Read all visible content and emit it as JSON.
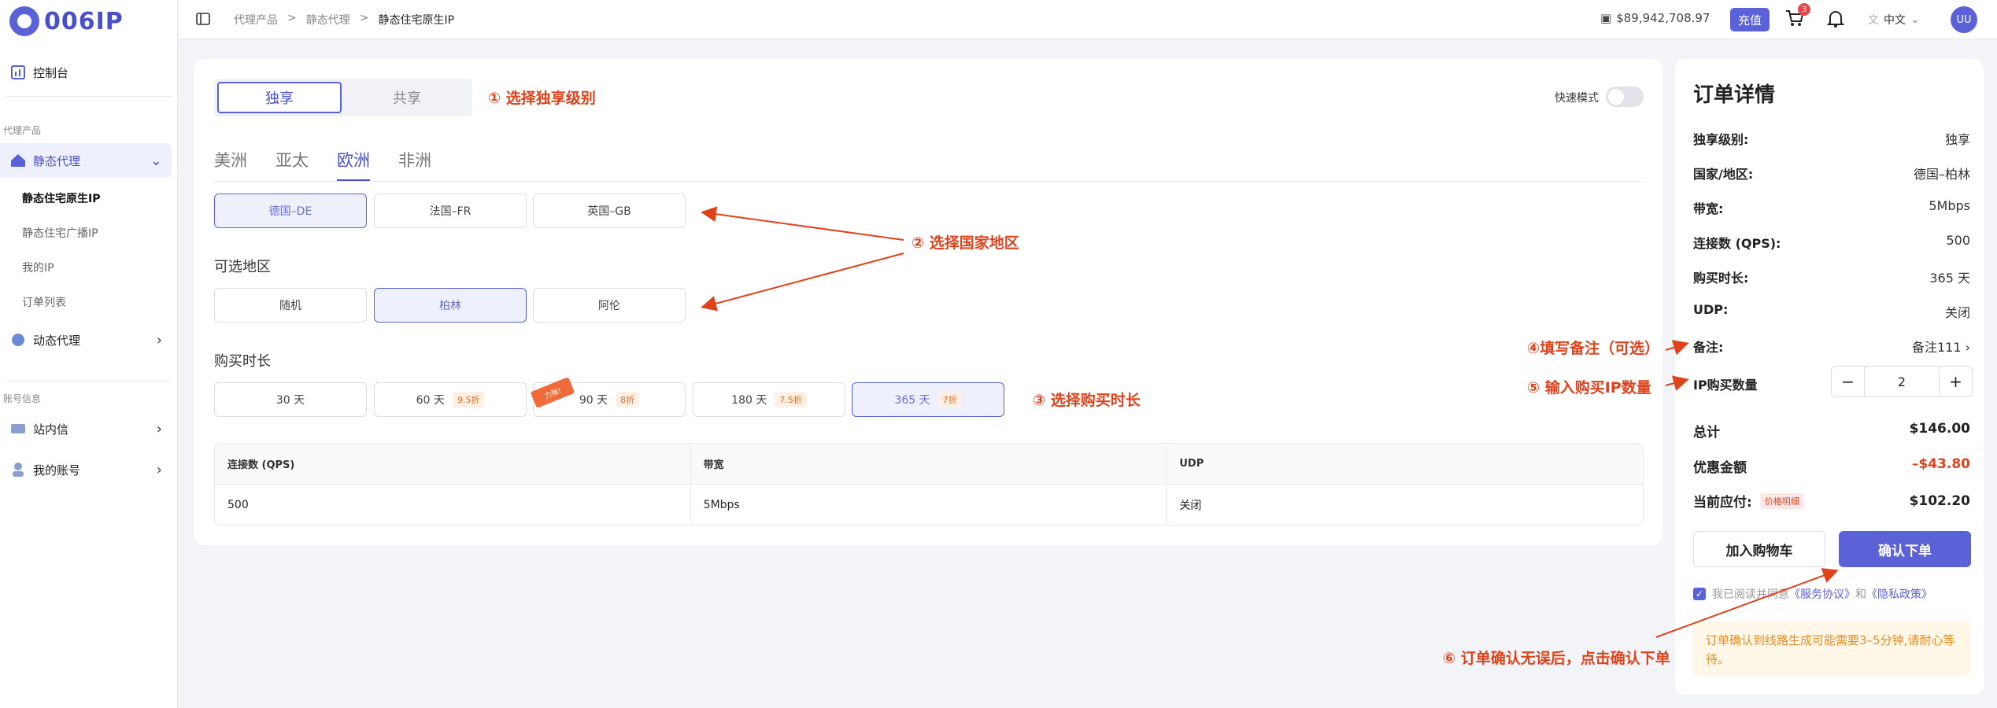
{
  "brand": {
    "logo_text": "006IP"
  },
  "sidebar": {
    "dashboard": "控制台",
    "sec_proxy": "代理产品",
    "static": "静态代理",
    "static_sub": [
      "静态住宅原生IP",
      "静态住宅广播IP",
      "我的IP",
      "订单列表"
    ],
    "dynamic": "动态代理",
    "sec_account": "账号信息",
    "inbox": "站内信",
    "account": "我的账号"
  },
  "topbar": {
    "crumbs": [
      "代理产品",
      ">",
      "静态代理",
      ">",
      "静态住宅原生IP"
    ],
    "balance": "$89,942,708.97",
    "recharge": "充值",
    "cart_badge": "3",
    "lang": "中文",
    "avatar": "UU"
  },
  "main": {
    "seg": [
      "独享",
      "共享"
    ],
    "quick_mode": "快速模式",
    "continents": [
      "美洲",
      "亚太",
      "欧洲",
      "非洲"
    ],
    "countries": [
      "德国–DE",
      "法国–FR",
      "英国–GB"
    ],
    "region_title": "可选地区",
    "regions": [
      "随机",
      "柏林",
      "阿伦"
    ],
    "duration_title": "购买时长",
    "durations": [
      {
        "label": "30 天",
        "disc": ""
      },
      {
        "label": "60 天",
        "disc": "9.5折"
      },
      {
        "label": "90 天",
        "disc": "8折"
      },
      {
        "label": "180 天",
        "disc": "7.5折"
      },
      {
        "label": "365 天",
        "disc": "7折"
      }
    ],
    "ribbon": "力推!",
    "table": {
      "headers": [
        "连接数 (QPS)",
        "带宽",
        "UDP"
      ],
      "row": [
        "500",
        "5Mbps",
        "关闭"
      ]
    }
  },
  "annotations": {
    "a1": "① 选择独享级别",
    "a2": "② 选择国家地区",
    "a3": "③ 选择购买时长",
    "a4": "④填写备注（可选）",
    "a5": "⑤ 输入购买IP数量",
    "a6": "⑥ 订单确认无误后，点击确认下单"
  },
  "order": {
    "title": "订单详情",
    "rows": [
      [
        "独享级别:",
        "独享"
      ],
      [
        "国家/地区:",
        "德国–柏林"
      ],
      [
        "带宽:",
        "5Mbps"
      ],
      [
        "连接数 (QPS):",
        "500"
      ],
      [
        "购买时长:",
        "365 天"
      ],
      [
        "UDP:",
        "关闭"
      ],
      [
        "备注:",
        "备注111"
      ]
    ],
    "qty_label": "IP购买数量",
    "qty": "2",
    "total_label": "总计",
    "total": "$146.00",
    "discount_label": "优惠金额",
    "discount": "–$43.80",
    "pay_label": "当前应付:",
    "price_detail": "价格明细",
    "pay": "$102.20",
    "add_cart": "加入购物车",
    "confirm": "确认下单",
    "agree_pre": "我已阅读并同意",
    "tos": "《服务协议》",
    "and": "和",
    "privacy": "《隐私政策》",
    "notice": "订单确认到线路生成可能需要3–5分钟,请耐心等待。"
  },
  "colors": {
    "accent": "#5b61d6",
    "annotation": "#e0421c",
    "discount": "#e0421c"
  }
}
